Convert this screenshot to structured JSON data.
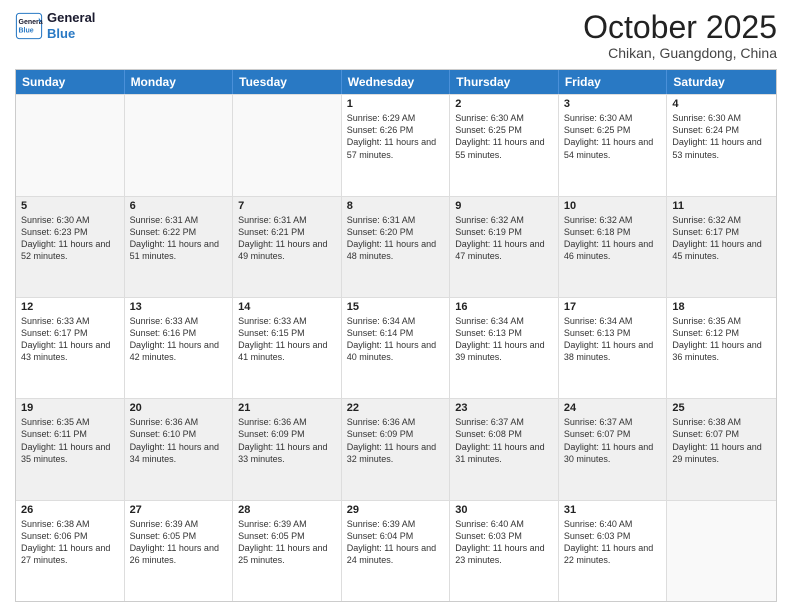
{
  "logo": {
    "line1": "General",
    "line2": "Blue"
  },
  "title": "October 2025",
  "location": "Chikan, Guangdong, China",
  "header_days": [
    "Sunday",
    "Monday",
    "Tuesday",
    "Wednesday",
    "Thursday",
    "Friday",
    "Saturday"
  ],
  "rows": [
    [
      {
        "day": "",
        "info": ""
      },
      {
        "day": "",
        "info": ""
      },
      {
        "day": "",
        "info": ""
      },
      {
        "day": "1",
        "info": "Sunrise: 6:29 AM\nSunset: 6:26 PM\nDaylight: 11 hours\nand 57 minutes."
      },
      {
        "day": "2",
        "info": "Sunrise: 6:30 AM\nSunset: 6:25 PM\nDaylight: 11 hours\nand 55 minutes."
      },
      {
        "day": "3",
        "info": "Sunrise: 6:30 AM\nSunset: 6:25 PM\nDaylight: 11 hours\nand 54 minutes."
      },
      {
        "day": "4",
        "info": "Sunrise: 6:30 AM\nSunset: 6:24 PM\nDaylight: 11 hours\nand 53 minutes."
      }
    ],
    [
      {
        "day": "5",
        "info": "Sunrise: 6:30 AM\nSunset: 6:23 PM\nDaylight: 11 hours\nand 52 minutes."
      },
      {
        "day": "6",
        "info": "Sunrise: 6:31 AM\nSunset: 6:22 PM\nDaylight: 11 hours\nand 51 minutes."
      },
      {
        "day": "7",
        "info": "Sunrise: 6:31 AM\nSunset: 6:21 PM\nDaylight: 11 hours\nand 49 minutes."
      },
      {
        "day": "8",
        "info": "Sunrise: 6:31 AM\nSunset: 6:20 PM\nDaylight: 11 hours\nand 48 minutes."
      },
      {
        "day": "9",
        "info": "Sunrise: 6:32 AM\nSunset: 6:19 PM\nDaylight: 11 hours\nand 47 minutes."
      },
      {
        "day": "10",
        "info": "Sunrise: 6:32 AM\nSunset: 6:18 PM\nDaylight: 11 hours\nand 46 minutes."
      },
      {
        "day": "11",
        "info": "Sunrise: 6:32 AM\nSunset: 6:17 PM\nDaylight: 11 hours\nand 45 minutes."
      }
    ],
    [
      {
        "day": "12",
        "info": "Sunrise: 6:33 AM\nSunset: 6:17 PM\nDaylight: 11 hours\nand 43 minutes."
      },
      {
        "day": "13",
        "info": "Sunrise: 6:33 AM\nSunset: 6:16 PM\nDaylight: 11 hours\nand 42 minutes."
      },
      {
        "day": "14",
        "info": "Sunrise: 6:33 AM\nSunset: 6:15 PM\nDaylight: 11 hours\nand 41 minutes."
      },
      {
        "day": "15",
        "info": "Sunrise: 6:34 AM\nSunset: 6:14 PM\nDaylight: 11 hours\nand 40 minutes."
      },
      {
        "day": "16",
        "info": "Sunrise: 6:34 AM\nSunset: 6:13 PM\nDaylight: 11 hours\nand 39 minutes."
      },
      {
        "day": "17",
        "info": "Sunrise: 6:34 AM\nSunset: 6:13 PM\nDaylight: 11 hours\nand 38 minutes."
      },
      {
        "day": "18",
        "info": "Sunrise: 6:35 AM\nSunset: 6:12 PM\nDaylight: 11 hours\nand 36 minutes."
      }
    ],
    [
      {
        "day": "19",
        "info": "Sunrise: 6:35 AM\nSunset: 6:11 PM\nDaylight: 11 hours\nand 35 minutes."
      },
      {
        "day": "20",
        "info": "Sunrise: 6:36 AM\nSunset: 6:10 PM\nDaylight: 11 hours\nand 34 minutes."
      },
      {
        "day": "21",
        "info": "Sunrise: 6:36 AM\nSunset: 6:09 PM\nDaylight: 11 hours\nand 33 minutes."
      },
      {
        "day": "22",
        "info": "Sunrise: 6:36 AM\nSunset: 6:09 PM\nDaylight: 11 hours\nand 32 minutes."
      },
      {
        "day": "23",
        "info": "Sunrise: 6:37 AM\nSunset: 6:08 PM\nDaylight: 11 hours\nand 31 minutes."
      },
      {
        "day": "24",
        "info": "Sunrise: 6:37 AM\nSunset: 6:07 PM\nDaylight: 11 hours\nand 30 minutes."
      },
      {
        "day": "25",
        "info": "Sunrise: 6:38 AM\nSunset: 6:07 PM\nDaylight: 11 hours\nand 29 minutes."
      }
    ],
    [
      {
        "day": "26",
        "info": "Sunrise: 6:38 AM\nSunset: 6:06 PM\nDaylight: 11 hours\nand 27 minutes."
      },
      {
        "day": "27",
        "info": "Sunrise: 6:39 AM\nSunset: 6:05 PM\nDaylight: 11 hours\nand 26 minutes."
      },
      {
        "day": "28",
        "info": "Sunrise: 6:39 AM\nSunset: 6:05 PM\nDaylight: 11 hours\nand 25 minutes."
      },
      {
        "day": "29",
        "info": "Sunrise: 6:39 AM\nSunset: 6:04 PM\nDaylight: 11 hours\nand 24 minutes."
      },
      {
        "day": "30",
        "info": "Sunrise: 6:40 AM\nSunset: 6:03 PM\nDaylight: 11 hours\nand 23 minutes."
      },
      {
        "day": "31",
        "info": "Sunrise: 6:40 AM\nSunset: 6:03 PM\nDaylight: 11 hours\nand 22 minutes."
      },
      {
        "day": "",
        "info": ""
      }
    ]
  ]
}
